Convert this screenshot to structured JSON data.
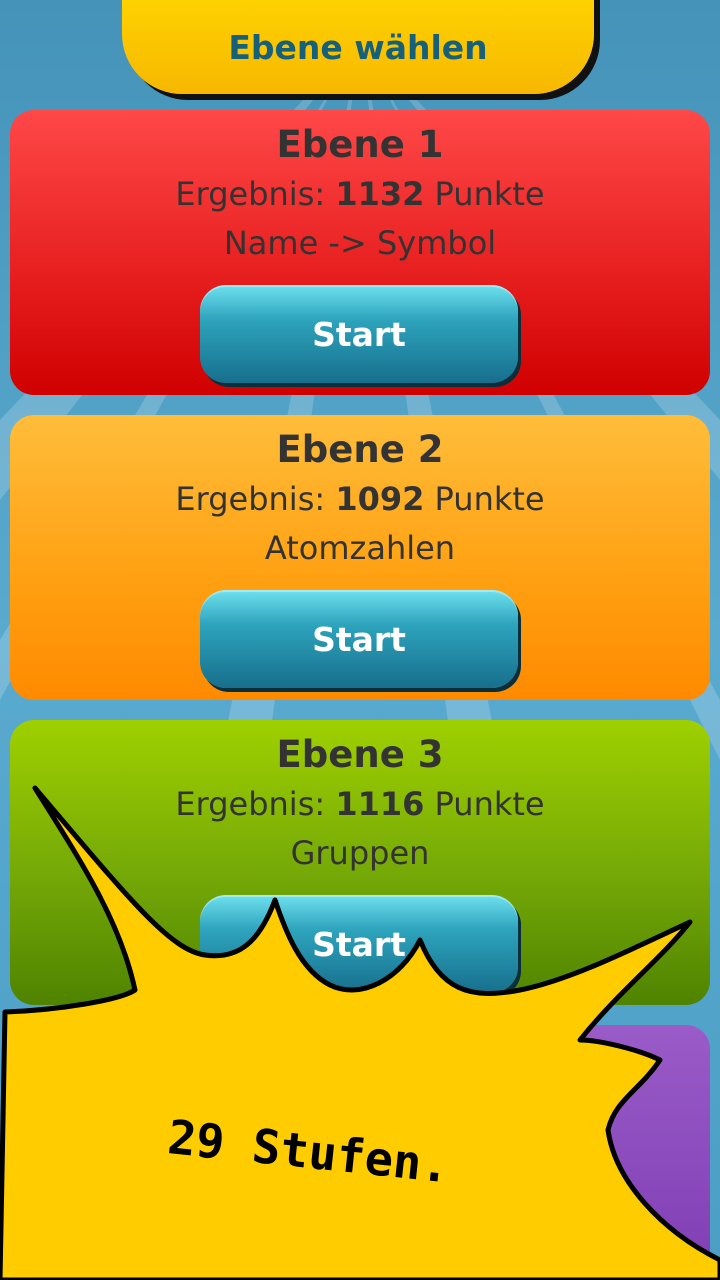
{
  "header": {
    "title": "Ebene wählen"
  },
  "levels": [
    {
      "title": "Ebene 1",
      "score_prefix": "Ergebnis:",
      "score": "1132",
      "score_suffix": "Punkte",
      "mode": "Name -> Symbol",
      "button": "Start",
      "color": "#e61d1d"
    },
    {
      "title": "Ebene 2",
      "score_prefix": "Ergebnis:",
      "score": "1092",
      "score_suffix": "Punkte",
      "mode": "Atomzahlen",
      "button": "Start",
      "color": "#ff9f10"
    },
    {
      "title": "Ebene 3",
      "score_prefix": "Ergebnis:",
      "score": "1116",
      "score_suffix": "Punkte",
      "mode": "Gruppen",
      "button": "Start",
      "color": "#74a807"
    },
    {
      "color": "#7a38b0"
    }
  ],
  "promo": {
    "text": "29 Stufen.",
    "color": "#ffcc00"
  }
}
